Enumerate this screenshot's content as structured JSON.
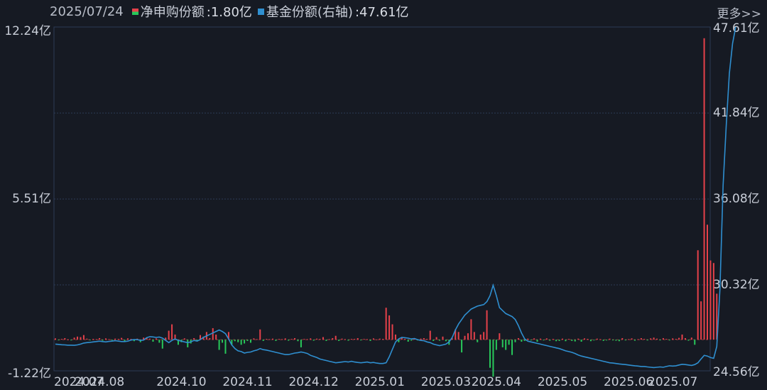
{
  "legend": {
    "date": "2025/07/24",
    "series1_label": "净申购份额",
    "series1_value": ":1.80亿",
    "series2_label": "基金份额(右轴)",
    "series2_value": ":47.61亿"
  },
  "more_label": "更多>>",
  "colors": {
    "background": "#161a23",
    "grid": "#2c3a55",
    "positive": "#e5414a",
    "negative": "#28c85a",
    "line": "#2f8fd0"
  },
  "chart_data": {
    "type": "bar+line",
    "left_axis": {
      "unit": "亿",
      "ticks": [
        "12.24亿",
        "5.51亿",
        "-1.22亿"
      ],
      "tick_values": [
        12.24,
        5.51,
        -1.22
      ],
      "ylim": [
        -1.22,
        12.24
      ]
    },
    "right_axis": {
      "unit": "亿",
      "ticks": [
        "47.61亿",
        "41.84亿",
        "36.08亿",
        "30.32亿",
        "24.56亿"
      ],
      "tick_values": [
        47.61,
        41.84,
        36.08,
        30.32,
        24.56
      ],
      "ylim": [
        24.56,
        47.61
      ]
    },
    "x_ticks": [
      "2024.07",
      "2024.08",
      "2024.10",
      "2024.11",
      "2024.12",
      "2025.01",
      "2025.03",
      "2025.04",
      "2025.05",
      "2025.06",
      "2025.07"
    ],
    "x_tick_index": [
      0,
      14,
      40,
      61,
      82,
      103,
      124,
      140,
      161,
      182,
      196
    ],
    "n": 208,
    "series": [
      {
        "name": "净申购份额",
        "type": "bar",
        "values": [
          0.05,
          -0.02,
          0.03,
          0.06,
          0.01,
          -0.03,
          0.08,
          0.12,
          0.1,
          0.18,
          0.04,
          -0.02,
          0.03,
          0.02,
          0.06,
          -0.04,
          0.05,
          0.02,
          -0.03,
          0.04,
          0.03,
          0.07,
          -0.05,
          0.05,
          0.03,
          -0.06,
          0.04,
          -0.1,
          0.08,
          0.06,
          0.04,
          -0.08,
          0.05,
          -0.12,
          -0.35,
          0.08,
          0.35,
          0.6,
          0.2,
          -0.2,
          -0.1,
          0.05,
          -0.3,
          -0.15,
          0.06,
          -0.05,
          0.18,
          0.12,
          0.3,
          0.06,
          0.45,
          0.2,
          -0.4,
          -0.12,
          -0.55,
          0.3,
          -0.2,
          -0.06,
          -0.1,
          -0.2,
          -0.15,
          -0.05,
          -0.12,
          0.05,
          0.02,
          0.4,
          -0.05,
          0.03,
          0.02,
          0.04,
          -0.05,
          0.03,
          0.02,
          0.05,
          -0.04,
          0.03,
          0.06,
          -0.06,
          -0.3,
          0.03,
          0.02,
          0.05,
          -0.04,
          0.04,
          0.03,
          0.1,
          -0.05,
          0.02,
          0.06,
          0.15,
          -0.05,
          0.04,
          0.02,
          -0.04,
          0.03,
          0.03,
          0.06,
          -0.03,
          0.03,
          0.02,
          -0.05,
          0.05,
          0.01,
          0.04,
          0.03,
          1.25,
          0.95,
          0.6,
          0.2,
          -0.1,
          0.08,
          0.03,
          -0.08,
          -0.04,
          0.05,
          -0.03,
          0.04,
          0.06,
          0.03,
          0.35,
          -0.05,
          0.1,
          -0.04,
          0.12,
          -0.06,
          -0.2,
          0.05,
          0.4,
          0.3,
          -0.5,
          0.15,
          0.25,
          0.8,
          0.3,
          -0.1,
          0.2,
          0.3,
          1.15,
          -1.1,
          -1.45,
          -0.4,
          0.25,
          -0.3,
          -0.4,
          -0.2,
          -0.6,
          -0.1,
          0.06,
          -0.08,
          -0.05,
          0.04,
          -0.03,
          0.05,
          -0.08,
          0.04,
          -0.03,
          0.05,
          -0.04,
          0.03,
          -0.06,
          -0.05,
          0.04,
          -0.06,
          0.03,
          -0.05,
          -0.07,
          0.04,
          -0.08,
          0.05,
          0.03,
          -0.06,
          -0.03,
          0.04,
          0.02,
          -0.05,
          -0.03,
          0.04,
          -0.02,
          -0.04,
          -0.06,
          0.06,
          -0.03,
          0.02,
          0.05,
          -0.04,
          0.02,
          0.06,
          0.03,
          -0.03,
          0.05,
          0.08,
          0.04,
          -0.02,
          0.06,
          0.03,
          -0.03,
          0.05,
          0.03,
          0.07,
          0.2,
          0.06,
          -0.04,
          0.08,
          -0.2,
          3.5,
          1.5,
          11.8,
          4.5,
          3.1,
          3.0,
          1.8
        ]
      },
      {
        "name": "基金份额(右轴)",
        "type": "line",
        "axis": "right",
        "values": [
          26.35,
          26.33,
          26.31,
          26.3,
          26.28,
          26.28,
          26.27,
          26.3,
          26.35,
          26.42,
          26.45,
          26.47,
          26.5,
          26.52,
          26.55,
          26.52,
          26.5,
          26.53,
          26.55,
          26.58,
          26.55,
          26.52,
          26.52,
          26.55,
          26.62,
          26.65,
          26.65,
          26.6,
          26.62,
          26.78,
          26.85,
          26.83,
          26.8,
          26.82,
          26.75,
          26.6,
          26.45,
          26.6,
          26.7,
          26.6,
          26.55,
          26.5,
          26.45,
          26.5,
          26.6,
          26.55,
          26.65,
          26.8,
          26.9,
          27.0,
          27.1,
          27.2,
          27.3,
          27.2,
          27.05,
          26.7,
          26.3,
          26.05,
          25.9,
          25.85,
          25.75,
          25.8,
          25.82,
          25.9,
          25.95,
          26.05,
          25.98,
          25.95,
          25.9,
          25.85,
          25.8,
          25.75,
          25.7,
          25.65,
          25.65,
          25.7,
          25.75,
          25.78,
          25.82,
          25.78,
          25.72,
          25.6,
          25.52,
          25.45,
          25.35,
          25.3,
          25.25,
          25.2,
          25.15,
          25.1,
          25.12,
          25.15,
          25.18,
          25.15,
          25.2,
          25.15,
          25.12,
          25.1,
          25.12,
          25.15,
          25.1,
          25.12,
          25.08,
          25.05,
          25.05,
          25.1,
          25.5,
          26.0,
          26.5,
          26.7,
          26.8,
          26.78,
          26.75,
          26.7,
          26.72,
          26.65,
          26.6,
          26.58,
          26.5,
          26.45,
          26.35,
          26.3,
          26.25,
          26.3,
          26.35,
          26.5,
          26.8,
          27.3,
          27.7,
          28.0,
          28.3,
          28.5,
          28.7,
          28.8,
          28.9,
          28.95,
          29.0,
          29.2,
          29.6,
          30.3,
          29.6,
          28.8,
          28.6,
          28.4,
          28.3,
          28.2,
          28.0,
          27.6,
          27.1,
          26.7,
          26.55,
          26.5,
          26.45,
          26.4,
          26.35,
          26.3,
          26.25,
          26.2,
          26.15,
          26.1,
          26.05,
          25.98,
          25.9,
          25.85,
          25.8,
          25.72,
          25.62,
          25.55,
          25.5,
          25.45,
          25.4,
          25.35,
          25.3,
          25.25,
          25.2,
          25.15,
          25.1,
          25.08,
          25.05,
          25.02,
          25.0,
          24.98,
          24.95,
          24.92,
          24.9,
          24.88,
          24.85,
          24.85,
          24.82,
          24.8,
          24.78,
          24.8,
          24.82,
          24.8,
          24.85,
          24.9,
          24.88,
          24.9,
          24.95,
          25.0,
          24.98,
          24.95,
          24.92,
          24.98,
          25.1,
          25.35,
          25.6,
          25.55,
          25.45,
          25.4,
          26.2,
          30.0,
          37.0,
          41.0,
          44.5,
          46.5,
          47.61
        ]
      }
    ]
  }
}
